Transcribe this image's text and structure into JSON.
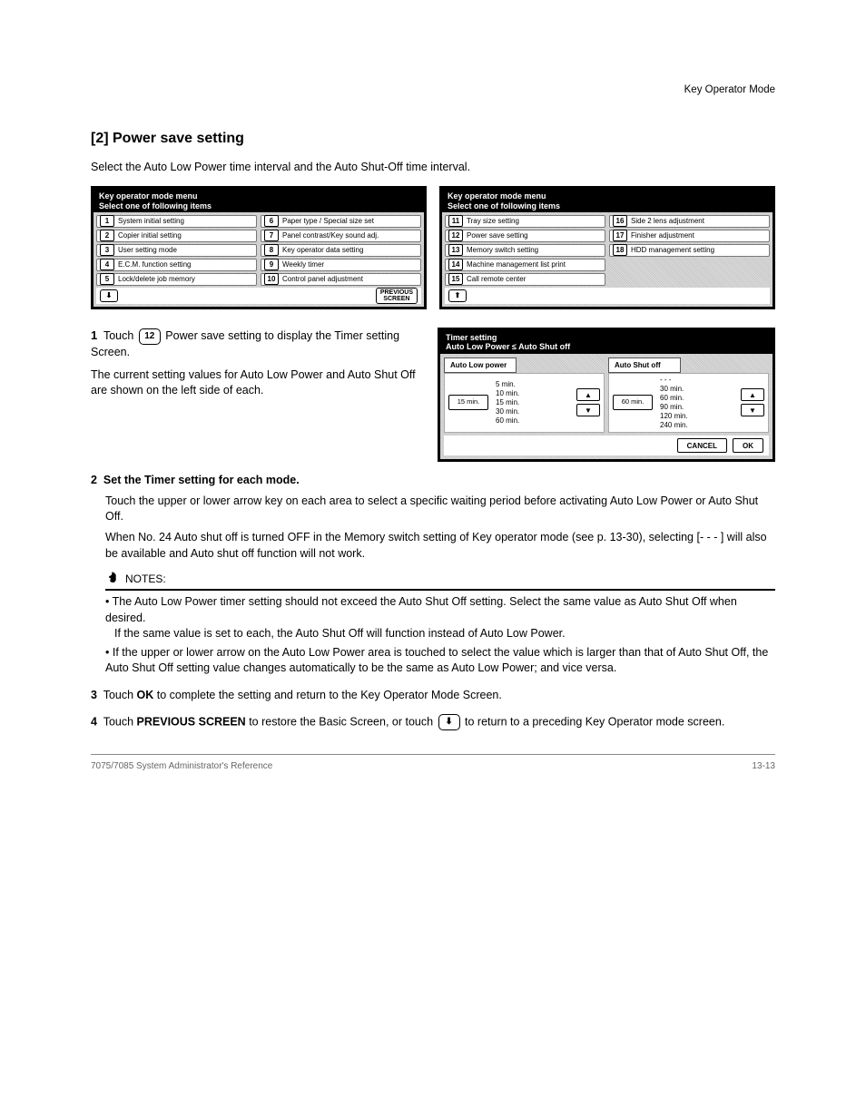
{
  "header_right": "Key Operator Mode",
  "title": "[2] Power save setting",
  "intro": "Select the Auto Low Power time interval and the Auto Shut-Off time interval.",
  "menu": {
    "title_l1": "Key operator mode menu",
    "title_l2": "Select one of following items",
    "left_items": [
      {
        "n": "1",
        "t": "System initial setting"
      },
      {
        "n": "2",
        "t": "Copier initial setting"
      },
      {
        "n": "3",
        "t": "User setting mode"
      },
      {
        "n": "4",
        "t": "E.C.M. function setting"
      },
      {
        "n": "5",
        "t": "Lock/delete job memory"
      },
      {
        "n": "6",
        "t": "Paper type / Special size set"
      },
      {
        "n": "7",
        "t": "Panel contrast/Key sound adj."
      },
      {
        "n": "8",
        "t": "Key operator data setting"
      },
      {
        "n": "9",
        "t": "Weekly timer"
      },
      {
        "n": "10",
        "t": "Control panel adjustment"
      }
    ],
    "right_items": [
      {
        "n": "11",
        "t": "Tray size setting"
      },
      {
        "n": "12",
        "t": "Power save setting"
      },
      {
        "n": "13",
        "t": "Memory switch setting"
      },
      {
        "n": "14",
        "t": "Machine management list print"
      },
      {
        "n": "15",
        "t": "Call remote center"
      },
      {
        "n": "16",
        "t": "Side 2 lens adjustment"
      },
      {
        "n": "17",
        "t": "Finisher adjustment"
      },
      {
        "n": "18",
        "t": "HDD management setting"
      }
    ],
    "prev_l1": "PREVIOUS",
    "prev_l2": "SCREEN"
  },
  "step1": {
    "num": "1",
    "line1": "Touch ",
    "btn": "12",
    "line2": " Power save setting to display the Timer setting Screen."
  },
  "timer_screen": {
    "title_l1": "Timer setting",
    "title_l2": "Auto Low Power ≤ Auto Shut off",
    "low": {
      "tab": "Auto Low power",
      "current": "15 min.",
      "options": [
        "5 min.",
        "10 min.",
        "15 min.",
        "30 min.",
        "60 min."
      ]
    },
    "shut": {
      "tab": "Auto Shut off",
      "current": "60 min.",
      "options": [
        "- - -",
        "30 min.",
        "60 min.",
        "90 min.",
        "120 min.",
        "240 min."
      ]
    },
    "cancel": "CANCEL",
    "ok": "OK"
  },
  "step2": "The current setting values for Auto Low Power and Auto Shut Off are shown on the left side of each.",
  "step2_num": "2",
  "step2_bold": "Set the Timer setting for each mode.",
  "step2_b1": "Touch the upper or lower arrow key on each area to select a specific waiting period before activating Auto Low Power or Auto Shut Off.",
  "step2_b2": "When No. 24 Auto shut off is turned OFF in the Memory switch setting of Key operator mode (see p. 13-30), selecting [- - - ] will also be available and Auto shut off function will not work.",
  "notes_label": "NOTES:",
  "note1_a": "The Auto Low Power timer setting should not exceed the Auto Shut Off setting. Select the same value as Auto Shut Off when desired.",
  "note1_b": "If the same value is set to each, the Auto Shut Off will function instead of Auto Low Power.",
  "note2": "If the upper or lower arrow on the Auto Low Power area is touched to select the value which is larger than that of Auto Shut Off, the Auto Shut Off setting value changes automatically to be the same as Auto Low Power; and vice versa.",
  "step3_num": "3",
  "step3a": "Touch ",
  "step3b": "OK",
  "step3c": " to complete the setting and return to the Key Operator Mode Screen.",
  "step4_num": "4",
  "step4a": "Touch ",
  "step4b": "PREVIOUS SCREEN",
  "step4c": " to restore the Basic Screen, or touch ",
  "step4d": " to return to a preceding Key Operator mode screen.",
  "footer_l": "7075/7085 System Administrator's Reference",
  "footer_r": "13-13"
}
